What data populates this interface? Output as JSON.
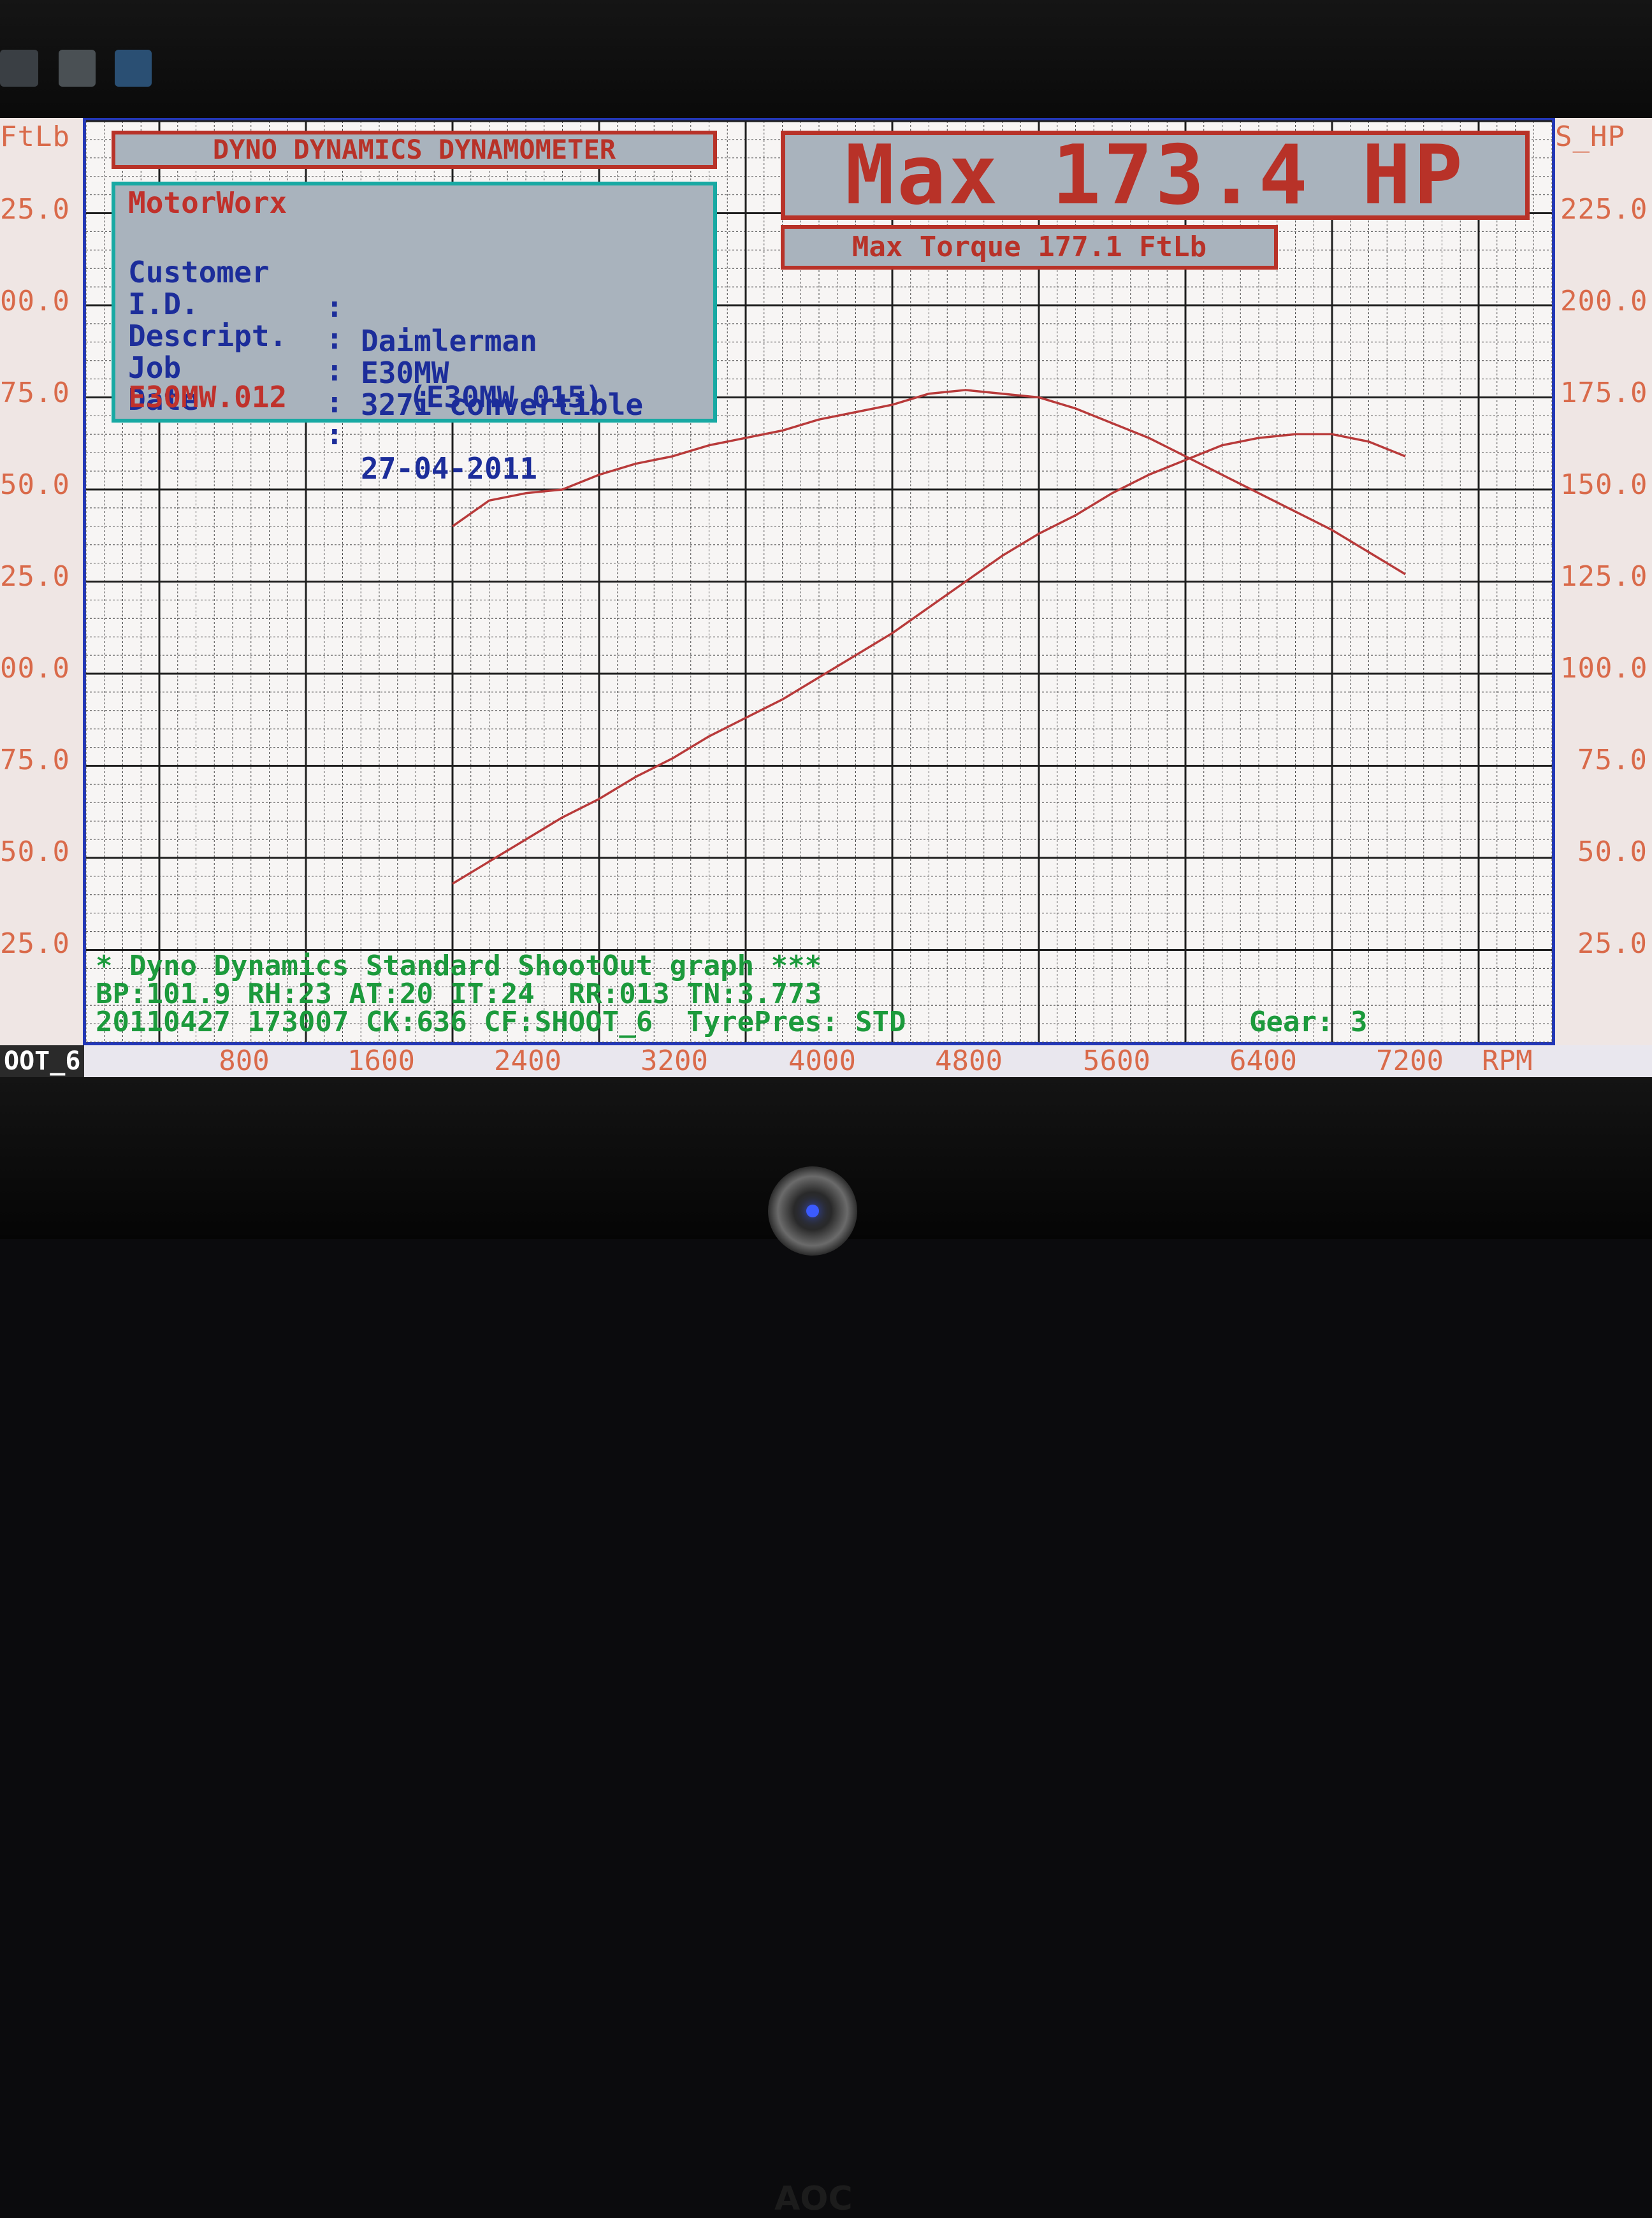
{
  "monitor": {
    "brand": "AOC"
  },
  "header": {
    "title": "DYNO DYNAMICS DYNAMOMETER",
    "company": "MotorWorx"
  },
  "info": {
    "rows": [
      {
        "label": "Customer",
        "value": "Daimlerman"
      },
      {
        "label": "I.D.",
        "value": "E30MW"
      },
      {
        "label": "Descript.",
        "value": "327i convertible"
      },
      {
        "label": "Job",
        "value": ""
      },
      {
        "label": "Date",
        "value": "27-04-2011"
      }
    ],
    "file_primary": "E30MW.012",
    "file_compare": "(E30MW.015)"
  },
  "summary": {
    "max_hp": "Max 173.4 HP",
    "max_torque": "Max Torque 177.1 FtLb"
  },
  "footer": {
    "line1": "* Dyno Dynamics Standard ShootOut graph ***",
    "line2": "BP:101.9 RH:23 AT:20 IT:24  RR:013 TN:3.773",
    "line3": "20110427 173007 CK:636 CF:SHOOT_6  TyrePres: STD",
    "gear": "Gear: 3",
    "shoot_label": "OOT_6"
  },
  "axes": {
    "left_unit": "FtLb",
    "right_unit": "S_HP",
    "x_unit": "RPM",
    "left_ticks": [
      "25.0",
      "00.0",
      "75.0",
      "50.0",
      "25.0",
      "00.0",
      "75.0",
      "50.0",
      "25.0"
    ],
    "right_ticks": [
      "225.0",
      "200.0",
      "175.0",
      "150.0",
      "125.0",
      "100.0",
      "75.0",
      "50.0",
      "25.0"
    ],
    "x_ticks": [
      "800",
      "1600",
      "2400",
      "3200",
      "4000",
      "4800",
      "5600",
      "6400",
      "7200"
    ]
  },
  "chart_data": {
    "type": "line",
    "x_label": "RPM",
    "xlim": [
      -400,
      7600
    ],
    "ylim": [
      0,
      250
    ],
    "y_right_label": "S_HP",
    "y_left_label": "FtLb",
    "grid": true,
    "line_color": "#b83a3a",
    "series": [
      {
        "x": [
          1600,
          1800,
          2000,
          2200,
          2400,
          2600,
          2800,
          3000,
          3200,
          3400,
          3600,
          3800,
          4000,
          4200,
          4400,
          4600,
          4800,
          5000,
          5200,
          5400,
          5600,
          5800,
          6000,
          6200,
          6400,
          6600,
          6800
        ],
        "y": [
          140,
          147,
          149,
          150,
          154,
          157,
          159,
          162,
          164,
          166,
          169,
          171,
          173,
          176,
          177,
          176,
          175,
          172,
          168,
          164,
          159,
          154,
          149,
          144,
          139,
          133,
          127
        ]
      },
      {
        "x": [
          1600,
          1800,
          2000,
          2200,
          2400,
          2600,
          2800,
          3000,
          3200,
          3400,
          3600,
          3800,
          4000,
          4200,
          4400,
          4600,
          4800,
          5000,
          5200,
          5400,
          5600,
          5800,
          6000,
          6200,
          6400,
          6600,
          6800
        ],
        "y": [
          43,
          49,
          55,
          61,
          66,
          72,
          77,
          83,
          88,
          93,
          99,
          105,
          111,
          118,
          125,
          132,
          138,
          143,
          149,
          154,
          158,
          162,
          164,
          165,
          165,
          163,
          159
        ]
      }
    ]
  }
}
